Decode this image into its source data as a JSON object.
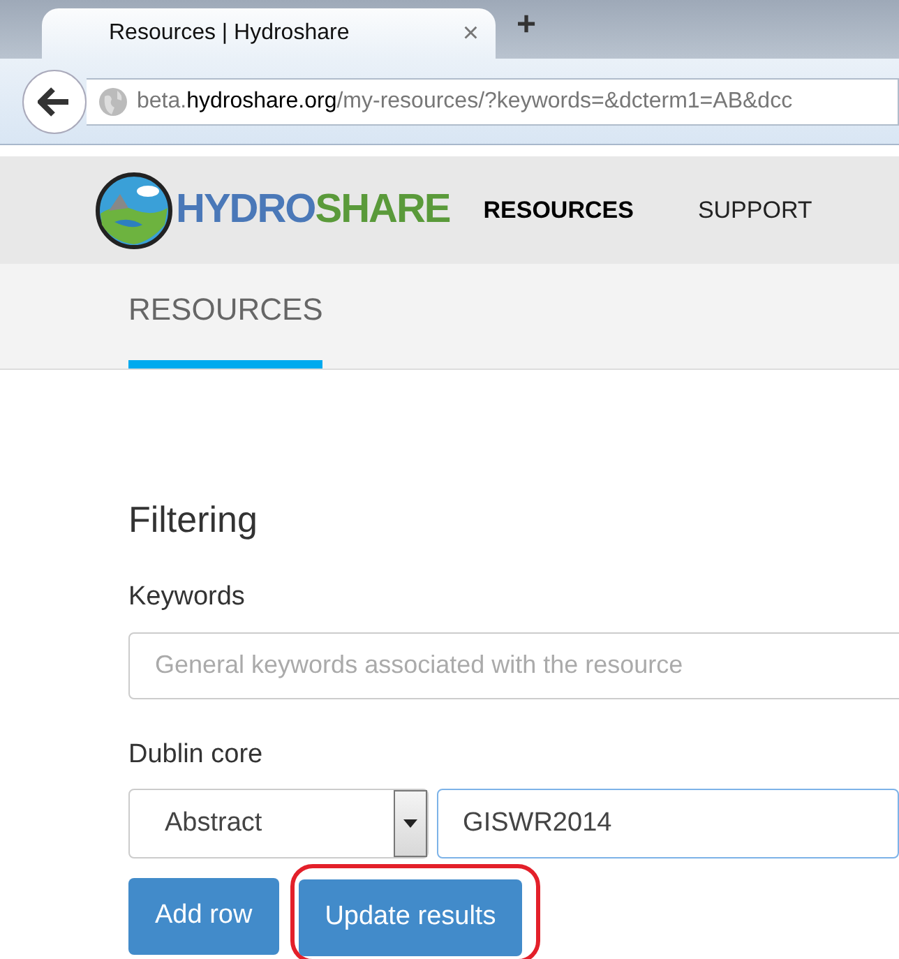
{
  "browser": {
    "tab_title": "Resources | Hydroshare",
    "tab_close": "×",
    "new_tab": "+",
    "url": "beta.**hydroshare.org**/my-resources/?keywords=&dcterm1=AB&dcc"
  },
  "logo": {
    "part_1": "HYDRO",
    "part_2": "SHARE"
  },
  "nav_items": [
    {
      "label": "RESOURCES",
      "selected": true
    },
    {
      "label": "SUPPORT",
      "selected": false
    }
  ],
  "sub_tabs": [
    {
      "label": "RESOURCES",
      "selected": true
    }
  ],
  "filtering": {
    "heading": "Filtering",
    "keywords_label": "Keywords",
    "keywords_placeholder": "General keywords associated with the resource",
    "dublin_label": "Dublin core",
    "term_select": "Abstract",
    "term_value": "GISWR2014",
    "buttons": [
      {
        "label": "Add row",
        "highlighted": false
      },
      {
        "label": "Update results",
        "highlighted": true
      }
    ]
  }
}
